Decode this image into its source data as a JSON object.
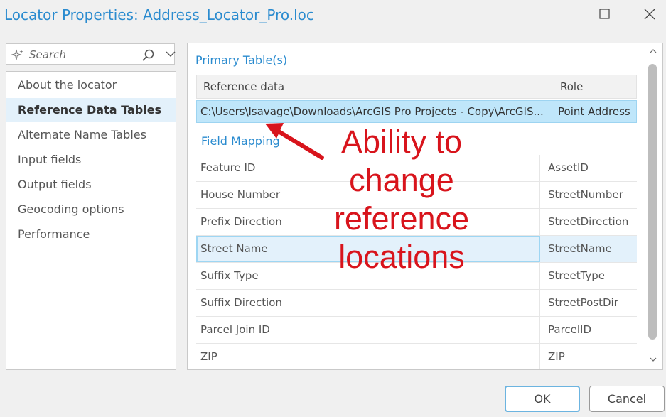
{
  "window": {
    "title": "Locator Properties: Address_Locator_Pro.loc"
  },
  "search": {
    "placeholder": "Search"
  },
  "nav": {
    "items": [
      {
        "label": "About the locator",
        "active": false
      },
      {
        "label": "Reference Data Tables",
        "active": true
      },
      {
        "label": "Alternate Name Tables",
        "active": false
      },
      {
        "label": "Input fields",
        "active": false
      },
      {
        "label": "Output fields",
        "active": false
      },
      {
        "label": "Geocoding options",
        "active": false
      },
      {
        "label": "Performance",
        "active": false
      }
    ]
  },
  "primary": {
    "title": "Primary Table(s)",
    "headers": {
      "reference": "Reference data",
      "role": "Role"
    },
    "row": {
      "reference": "C:\\Users\\lsavage\\Downloads\\ArcGIS Pro Projects - Copy\\ArcGIS...",
      "role": "Point Address"
    }
  },
  "field_mapping": {
    "title": "Field Mapping",
    "rows": [
      {
        "field": "Feature ID",
        "value": "AssetID"
      },
      {
        "field": "House Number",
        "value": "StreetNumber"
      },
      {
        "field": "Prefix Direction",
        "value": "StreetDirection"
      },
      {
        "field": "Street Name",
        "value": "StreetName"
      },
      {
        "field": "Suffix Type",
        "value": "StreetType"
      },
      {
        "field": "Suffix Direction",
        "value": "StreetPostDir"
      },
      {
        "field": "Parcel Join ID",
        "value": "ParcelID"
      },
      {
        "field": "ZIP",
        "value": "ZIP"
      }
    ]
  },
  "annotation": {
    "lines": [
      "Ability to",
      "change",
      "reference",
      "locations"
    ],
    "color": "#d8141c"
  },
  "buttons": {
    "ok": "OK",
    "cancel": "Cancel"
  },
  "colors": {
    "accent": "#2a8bcf",
    "selection": "#bfe6fa",
    "nav_active": "#e3f1fb"
  }
}
